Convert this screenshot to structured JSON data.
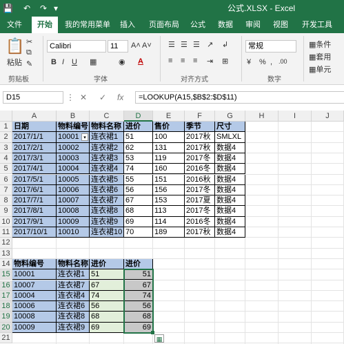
{
  "titlebar": {
    "title": "公式.XLSX  -  Excel"
  },
  "tabs": [
    "文件",
    "开始",
    "我的常用菜单",
    "插入",
    "页面布局",
    "公式",
    "数据",
    "审阅",
    "视图",
    "开发工具"
  ],
  "ribbon": {
    "paste_label": "粘贴",
    "font_name": "Calibri",
    "font_size": "11",
    "bold": "B",
    "italic": "I",
    "underline": "U",
    "number_format": "常规",
    "styles": [
      "条件",
      "套用",
      "单元"
    ],
    "group_labels": [
      "剪贴板",
      "字体",
      "对齐方式",
      "数字"
    ]
  },
  "formula_bar": {
    "name_box": "D15",
    "fx": "fx",
    "formula": "=LOOKUP(A15,$B$2:$D$11)"
  },
  "columns": [
    "A",
    "B",
    "C",
    "D",
    "E",
    "F",
    "G",
    "H",
    "I",
    "J"
  ],
  "rows": [
    "1",
    "2",
    "3",
    "4",
    "5",
    "6",
    "7",
    "8",
    "9",
    "10",
    "11",
    "12",
    "13",
    "14",
    "15",
    "16",
    "17",
    "18",
    "19",
    "20",
    "21"
  ],
  "table1": {
    "headers": [
      "日期",
      "物料编号",
      "物料名称",
      "进价",
      "售价",
      "季节",
      "尺寸"
    ],
    "rows": [
      [
        "2017/1/1",
        "10001",
        "连衣裙1",
        "51",
        "100",
        "2017秋",
        "SMLXL"
      ],
      [
        "2017/2/1",
        "10002",
        "连衣裙2",
        "62",
        "131",
        "2017秋",
        "数据4"
      ],
      [
        "2017/3/1",
        "10003",
        "连衣裙3",
        "53",
        "119",
        "2017冬",
        "数据4"
      ],
      [
        "2017/4/1",
        "10004",
        "连衣裙4",
        "74",
        "160",
        "2016冬",
        "数据4"
      ],
      [
        "2017/5/1",
        "10005",
        "连衣裙5",
        "55",
        "151",
        "2016秋",
        "数据4"
      ],
      [
        "2017/6/1",
        "10006",
        "连衣裙6",
        "56",
        "156",
        "2017冬",
        "数据4"
      ],
      [
        "2017/7/1",
        "10007",
        "连衣裙7",
        "67",
        "153",
        "2017夏",
        "数据4"
      ],
      [
        "2017/8/1",
        "10008",
        "连衣裙8",
        "68",
        "113",
        "2017冬",
        "数据4"
      ],
      [
        "2017/9/1",
        "10009",
        "连衣裙9",
        "69",
        "114",
        "2016冬",
        "数据4"
      ],
      [
        "2017/10/1",
        "10010",
        "连衣裙10",
        "70",
        "189",
        "2017秋",
        "数据4"
      ]
    ]
  },
  "table2": {
    "headers": [
      "物料编号",
      "物料名称",
      "进价",
      "进价"
    ],
    "rows": [
      [
        "10001",
        "连衣裙1",
        "51",
        "51"
      ],
      [
        "10007",
        "连衣裙7",
        "67",
        "67"
      ],
      [
        "10004",
        "连衣裙4",
        "74",
        "74"
      ],
      [
        "10006",
        "连衣裙6",
        "56",
        "56"
      ],
      [
        "10008",
        "连衣裙8",
        "68",
        "68"
      ],
      [
        "10009",
        "连衣裙9",
        "69",
        "69"
      ]
    ]
  },
  "colors": {
    "accent": "#217346",
    "header_fill": "#b4c9e7",
    "green_fill": "#e2efda",
    "gray_fill": "#c8c8c8"
  }
}
